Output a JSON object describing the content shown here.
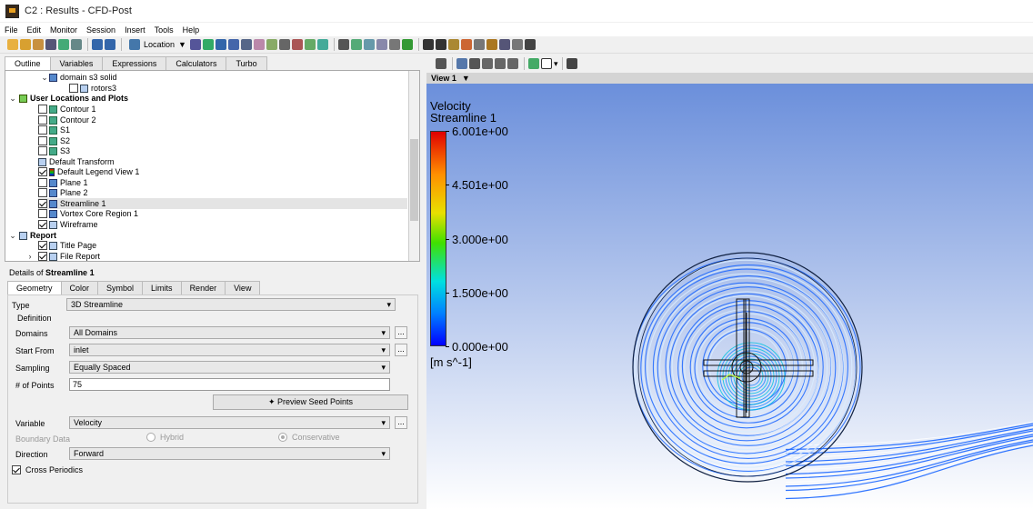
{
  "window": {
    "title": "C2 : Results - CFD-Post"
  },
  "menu": [
    "File",
    "Edit",
    "Monitor",
    "Session",
    "Insert",
    "Tools",
    "Help"
  ],
  "toolbar": {
    "location_label": "Location"
  },
  "outline_tabs": [
    "Outline",
    "Variables",
    "Expressions",
    "Calculators",
    "Turbo"
  ],
  "tree": {
    "domain": "domain s3 solid",
    "rotors": "rotors3",
    "user_locations": "User Locations and Plots",
    "contour1": "Contour 1",
    "contour2": "Contour 2",
    "s1": "S1",
    "s2": "S2",
    "s3": "S3",
    "default_transform": "Default Transform",
    "default_legend": "Default Legend View 1",
    "plane1": "Plane 1",
    "plane2": "Plane 2",
    "streamline1": "Streamline 1",
    "vortex": "Vortex Core Region 1",
    "wireframe": "Wireframe",
    "report": "Report",
    "title_page": "Title Page",
    "file_report": "File Report"
  },
  "details": {
    "prefix": "Details of",
    "object": "Streamline 1",
    "tabs": [
      "Geometry",
      "Color",
      "Symbol",
      "Limits",
      "Render",
      "View"
    ],
    "type_label": "Type",
    "type_value": "3D Streamline",
    "definition_label": "Definition",
    "domains_label": "Domains",
    "domains_value": "All Domains",
    "start_label": "Start From",
    "start_value": "inlet",
    "sampling_label": "Sampling",
    "sampling_value": "Equally Spaced",
    "points_label": "# of Points",
    "points_value": "75",
    "preview_button": "Preview Seed Points",
    "variable_label": "Variable",
    "variable_value": "Velocity",
    "boundary_label": "Boundary Data",
    "hybrid_label": "Hybrid",
    "conservative_label": "Conservative",
    "direction_label": "Direction",
    "direction_value": "Forward",
    "cross_periodics_label": "Cross Periodics",
    "ellipsis": "..."
  },
  "view": {
    "name": "View 1"
  },
  "legend": {
    "title": "Velocity",
    "subtitle": "Streamline 1",
    "ticks": [
      "6.001e+00",
      "4.501e+00",
      "3.000e+00",
      "1.500e+00",
      "0.000e+00"
    ],
    "units": "[m s^-1]"
  },
  "colors": {
    "streamline": "#1a66ff",
    "background_top": "#6b8fdb"
  }
}
